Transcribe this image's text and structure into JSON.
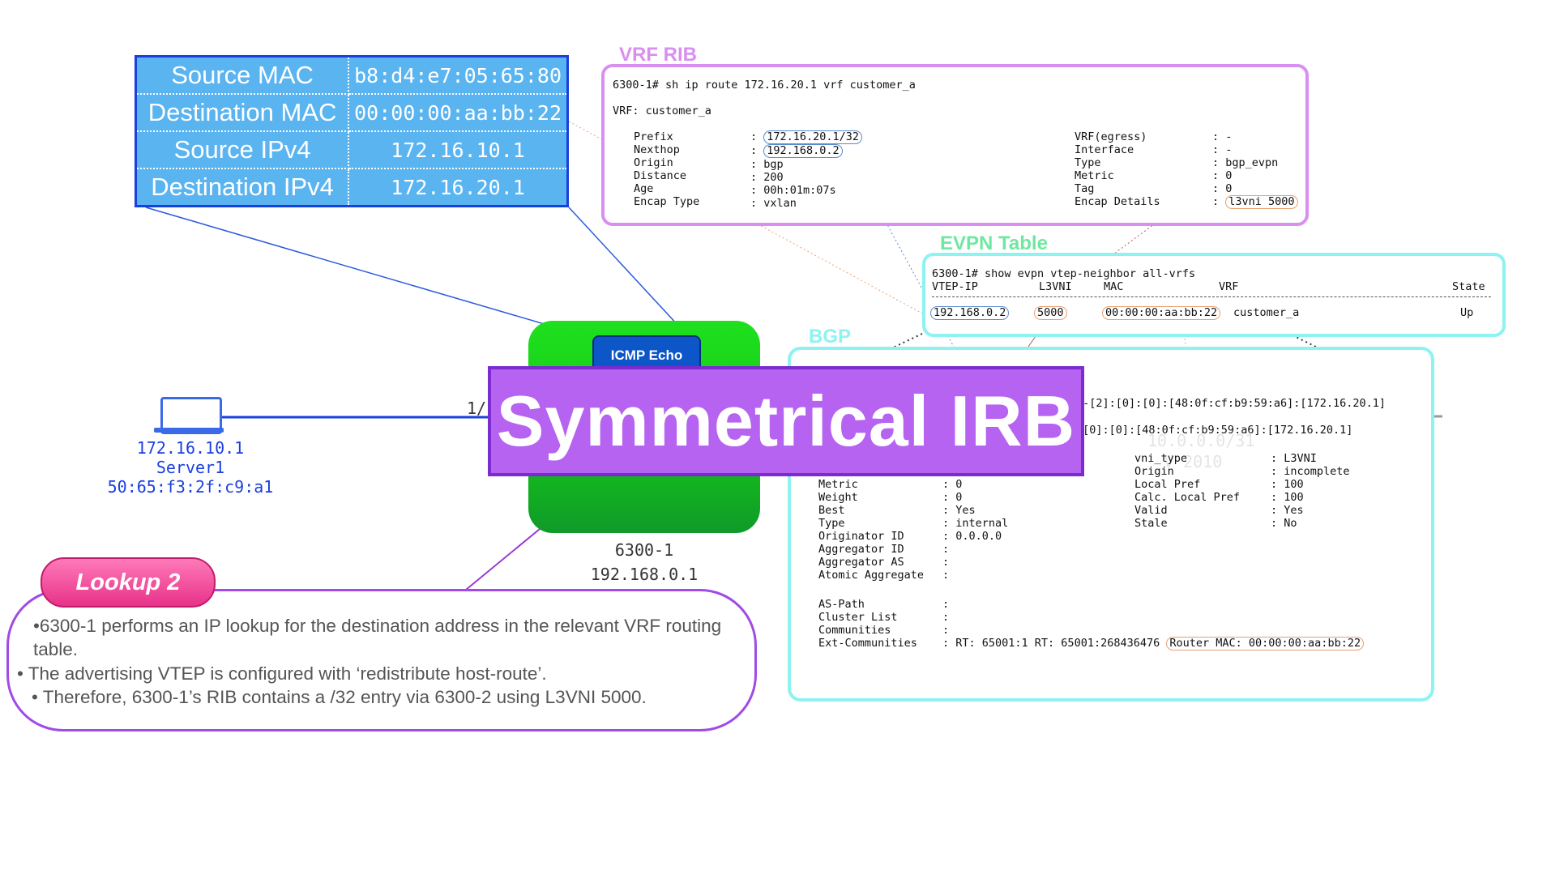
{
  "packet_header": {
    "rows": [
      {
        "field": "Source MAC",
        "value": "b8:d4:e7:05:65:80"
      },
      {
        "field": "Destination MAC",
        "value": "00:00:00:aa:bb:22"
      },
      {
        "field": "Source IPv4",
        "value": "172.16.10.1"
      },
      {
        "field": "Destination IPv4",
        "value": "172.16.20.1"
      }
    ]
  },
  "vrf_rib": {
    "tag": "VRF RIB",
    "command": "6300-1# sh ip route 172.16.20.1 vrf customer_a",
    "vrf_line": "VRF: customer_a",
    "left": [
      {
        "k": "Prefix",
        "v": "172.16.20.1/32"
      },
      {
        "k": "Nexthop",
        "v": "192.168.0.2"
      },
      {
        "k": "Origin",
        "v": "bgp"
      },
      {
        "k": "Distance",
        "v": "200"
      },
      {
        "k": "Age",
        "v": "00h:01m:07s"
      },
      {
        "k": "Encap Type",
        "v": "vxlan"
      }
    ],
    "right": [
      {
        "k": "VRF(egress)",
        "v": "-"
      },
      {
        "k": "Interface",
        "v": "-"
      },
      {
        "k": "Type",
        "v": "bgp_evpn"
      },
      {
        "k": "Metric",
        "v": "0"
      },
      {
        "k": "Tag",
        "v": "0"
      },
      {
        "k": "Encap Details",
        "v": "l3vni 5000"
      }
    ]
  },
  "evpn_table": {
    "tag": "EVPN Table",
    "command": "6300-1# show evpn vtep-neighbor all-vrfs",
    "headers": [
      "VTEP-IP",
      "L3VNI",
      "MAC",
      "VRF",
      "State"
    ],
    "row": {
      "vtep_ip": "192.168.0.2",
      "l3vni": "5000",
      "mac": "00:00:00:aa:bb:22",
      "vrf": "customer_a",
      "state": "Up"
    }
  },
  "bgp": {
    "tag": "BGP",
    "route_line1": "0-[2]:[0]:[0]:[48:0f:cf:b9:59:a6]:[172.16.20.1]",
    "route_line2": ":[0]:[0]:[48:0f:cf:b9:59:a6]:[172.16.20.1]",
    "ghost_text1": "10.0.0.0/31",
    "ghost_text2": "V 2010",
    "left": [
      {
        "k": "Metric",
        "v": "0"
      },
      {
        "k": "Weight",
        "v": "0"
      },
      {
        "k": "Best",
        "v": "Yes"
      },
      {
        "k": "Type",
        "v": "internal"
      },
      {
        "k": "Originator ID",
        "v": "0.0.0.0"
      },
      {
        "k": "Aggregator ID",
        "v": ""
      },
      {
        "k": "Aggregator AS",
        "v": ""
      },
      {
        "k": "Atomic Aggregate",
        "v": ""
      }
    ],
    "right": [
      {
        "k": "vni_type",
        "v": "L3VNI"
      },
      {
        "k": "Origin",
        "v": "incomplete"
      },
      {
        "k": "Local Pref",
        "v": "100"
      },
      {
        "k": "Calc. Local Pref",
        "v": "100"
      },
      {
        "k": "Valid",
        "v": "Yes"
      },
      {
        "k": "Stale",
        "v": "No"
      }
    ],
    "bottom": [
      {
        "k": "AS-Path",
        "v": ""
      },
      {
        "k": "Cluster List",
        "v": ""
      },
      {
        "k": "Communities",
        "v": ""
      }
    ],
    "ext_key": "Ext-Communities",
    "ext_value": "RT: 65001:1 RT: 65001:268436476",
    "router_mac": "Router MAC: 00:00:00:aa:bb:22"
  },
  "switch": {
    "icmp_label": "ICMP Echo",
    "banner": "Symmetrical IRB",
    "name": "6300-1",
    "ip": "192.168.0.1"
  },
  "server": {
    "ip": "172.16.10.1",
    "name": "Server1",
    "mac": "50:65:f3:2f:c9:a1",
    "port_label": "1/"
  },
  "lookup": {
    "title": "Lookup 2",
    "lines": [
      "•6300-1 performs an IP lookup for the destination address in the relevant VRF routing table.",
      "• The advertising VTEP is configured with ‘redistribute host-route’.",
      "• Therefore, 6300-1’s RIB contains a /32 entry via 6300-2 using L3VNI 5000."
    ]
  },
  "colors": {
    "vrf": "#d98ff0",
    "evpn": "#8ef3f0",
    "switch": "#16c816",
    "banner": "#b563f0",
    "lookup": "#e8328a",
    "header_table": "#5ab4f0"
  }
}
